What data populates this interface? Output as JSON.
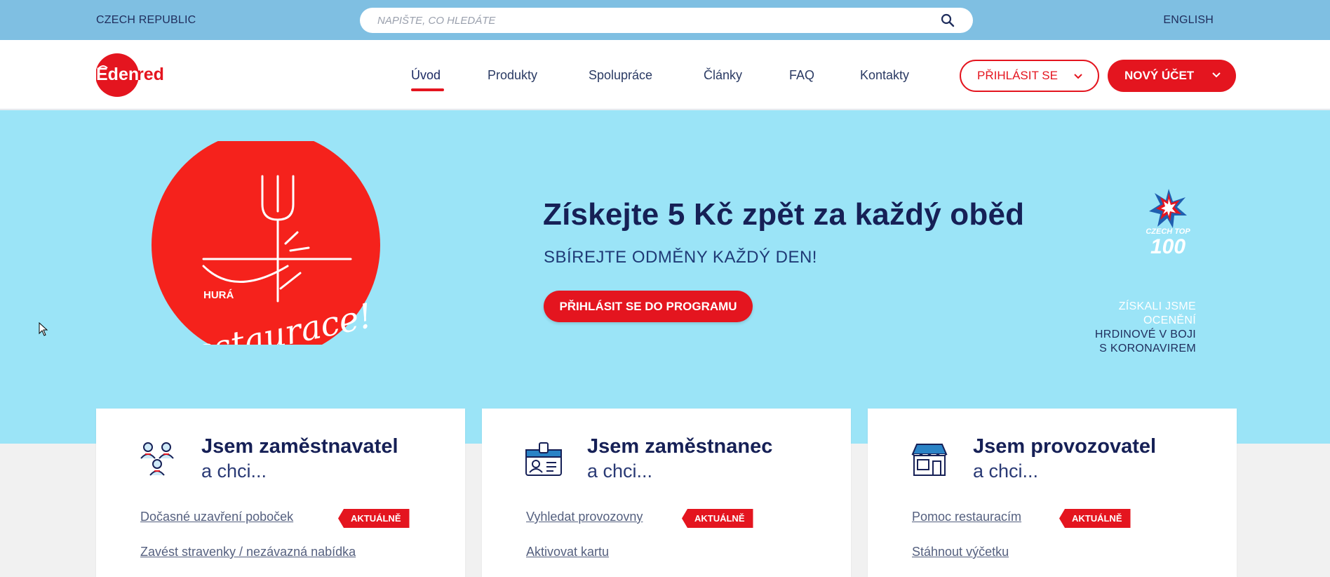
{
  "topbar": {
    "country": "CZECH REPUBLIC",
    "language": "ENGLISH",
    "search_placeholder": "NAPIŠTE, CO HLEDÁTE",
    "search_icon": "search-icon"
  },
  "navbar": {
    "logo_text": "Edenred",
    "items": [
      {
        "label": "Úvod",
        "active": true
      },
      {
        "label": "Produkty"
      },
      {
        "label": "Spolupráce"
      },
      {
        "label": "Články"
      },
      {
        "label": "FAQ"
      },
      {
        "label": "Kontakty"
      }
    ],
    "login_label": "PŘIHLÁSIT SE",
    "new_account_label": "NOVÝ ÚČET",
    "brand_color": "#e4151f"
  },
  "hero": {
    "illustration_label_top": "HURÁ",
    "illustration_label_script": "do restaurace!",
    "title": "Získejte 5 Kč zpět za každý oběd",
    "subtitle": "SBÍREJTE ODMĚNY KAŽDÝ DEN!",
    "cta_label": "PŘIHLÁSIT SE DO PROGRAMU",
    "award_logo_text_1": "CZECH TOP",
    "award_logo_text_2": "100",
    "award_line_1": "ZÍSKALI JSME",
    "award_line_2": "OCENĚNÍ",
    "award_line_3": "HRDINOVÉ V BOJI",
    "award_line_4": "S KORONAVIREM",
    "background_color": "#9be4f7"
  },
  "cards": [
    {
      "icon": "employees-group-icon",
      "title": "Jsem zaměstnavatel",
      "subtitle": "a chci...",
      "links": [
        {
          "label": "Dočasné uzavření poboček",
          "badge": "AKTUÁLNĚ"
        },
        {
          "label": "Zavést stravenky / nezávazná nabídka"
        }
      ]
    },
    {
      "icon": "id-card-icon",
      "title": "Jsem zaměstnanec",
      "subtitle": "a chci...",
      "links": [
        {
          "label": "Vyhledat provozovny",
          "badge": "AKTUÁLNĚ"
        },
        {
          "label": "Aktivovat kartu"
        }
      ]
    },
    {
      "icon": "storefront-icon",
      "title": "Jsem provozovatel",
      "subtitle": "a chci...",
      "links": [
        {
          "label": "Pomoc restauracím",
          "badge": "AKTUÁLNĚ"
        },
        {
          "label": "Stáhnout výčetku"
        }
      ]
    }
  ]
}
